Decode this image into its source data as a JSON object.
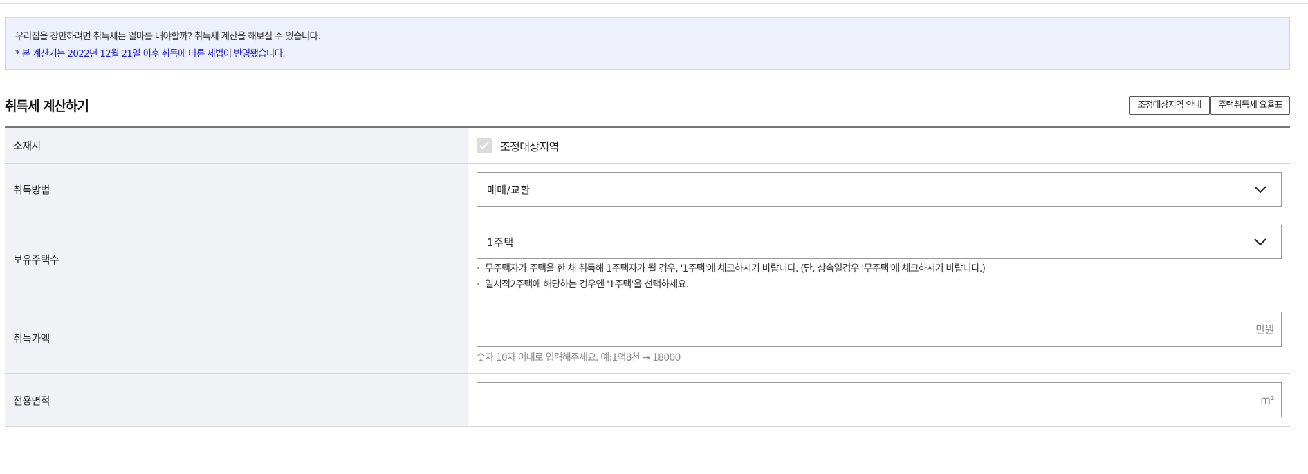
{
  "notice": {
    "line1": "우리집을 장만하려면 취득세는 얼마를 내야할까? 취득세 계산을 해보실 수 있습니다.",
    "line2": "* 본 계산기는 2022년 12월 21일 이후 취득에 따른 세법이 반영됐습니다."
  },
  "header": {
    "title": "취득세 계산하기",
    "btn_regulated_area": "조정대상지역 안내",
    "btn_tax_rate_table": "주택취득세 요율표"
  },
  "form": {
    "location": {
      "label": "소재지",
      "checkbox_label": "조정대상지역",
      "checked": true
    },
    "method": {
      "label": "취득방법",
      "selected": "매매/교환"
    },
    "houses": {
      "label": "보유주택수",
      "selected": "1주택",
      "note1": "무주택자가 주택을 한 채 취득해 1주택자가 될 경우, '1주택'에 체크하시기 바랍니다. (단, 상속일경우 '무주택'에 체크하시기 바랍니다.)",
      "note2": "일시적2주택에 해당하는 경우엔 '1주택'을 선택하세요.",
      "bullet": "·"
    },
    "price": {
      "label": "취득가액",
      "value": "",
      "unit": "만원",
      "hint": "숫자 10자 이내로 입력해주세요. 예:1억8천 → 18000"
    },
    "area": {
      "label": "전용면적",
      "value": "",
      "unit": "m²"
    }
  },
  "icons": {
    "check": "check-icon",
    "dropdown": "chevron-down-icon"
  },
  "colors": {
    "notice_bg": "#eef0fb",
    "notice_highlight": "#1a1fd6",
    "label_cell_bg": "#f1f2f5"
  }
}
